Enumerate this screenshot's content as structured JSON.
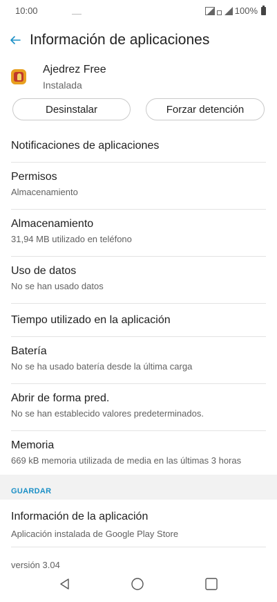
{
  "status_bar": {
    "time": "10:00",
    "battery": "100%",
    "icons": [
      "signal-box-icon",
      "signal-small-icon",
      "signal-icon",
      "battery-icon"
    ]
  },
  "header": {
    "title": "Información de aplicaciones",
    "back_icon": "back-arrow-icon",
    "accent_color": "#1a8fc6"
  },
  "app": {
    "name": "Ajedrez Free",
    "status": "Instalada",
    "icon": "chess-app-icon"
  },
  "actions": {
    "uninstall_label": "Desinstalar",
    "force_stop_label": "Forzar detención"
  },
  "settings": [
    {
      "title": "Notificaciones de aplicaciones",
      "subtitle": ""
    },
    {
      "title": "Permisos",
      "subtitle": "Almacenamiento"
    },
    {
      "title": "Almacenamiento",
      "subtitle": "31,94 MB utilizado en teléfono"
    },
    {
      "title": "Uso de datos",
      "subtitle": "No se han usado datos"
    },
    {
      "title": "Tiempo utilizado en la aplicación",
      "subtitle": ""
    },
    {
      "title": "Batería",
      "subtitle": "No se ha usado batería desde la última carga"
    },
    {
      "title": "Abrir de forma pred.",
      "subtitle": "No se han establecido valores predeterminados."
    },
    {
      "title": "Memoria",
      "subtitle": "669 kB memoria utilizada de media en las últimas 3 horas"
    }
  ],
  "store_section": {
    "label": "GUARDAR",
    "item_title": "Información de la aplicación",
    "item_subtitle": "Aplicación instalada de Google Play Store"
  },
  "version": "versión 3.04",
  "nav_bar": {
    "icons": [
      "nav-back-icon",
      "nav-home-icon",
      "nav-recents-icon"
    ]
  }
}
